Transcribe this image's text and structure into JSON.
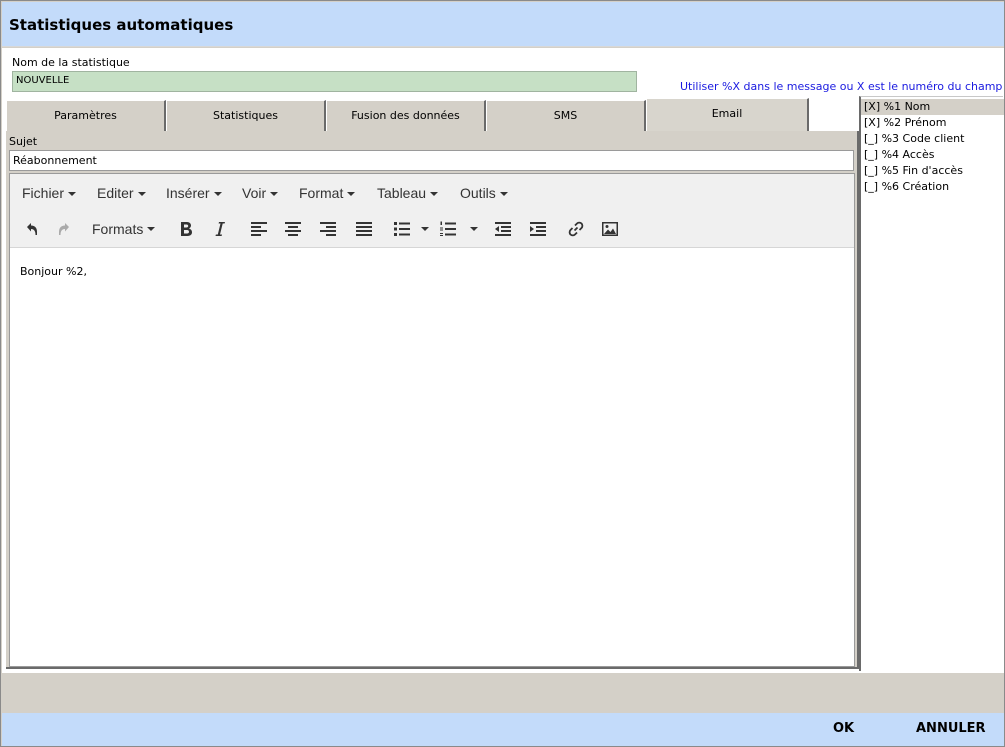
{
  "window": {
    "title": "Statistiques automatiques"
  },
  "form": {
    "name_label": "Nom de la statistique",
    "name_value": "NOUVELLE",
    "hint": "Utiliser %X dans le message ou X est le numéro du champ"
  },
  "tabs": [
    {
      "label": "Paramètres",
      "active": false
    },
    {
      "label": "Statistiques",
      "active": false
    },
    {
      "label": "Fusion des données",
      "active": false
    },
    {
      "label": "SMS",
      "active": false
    },
    {
      "label": "Email",
      "active": true
    }
  ],
  "email": {
    "subject_label": "Sujet",
    "subject_value": "Réabonnement",
    "menubar": [
      "Fichier",
      "Editer",
      "Insérer",
      "Voir",
      "Format",
      "Tableau",
      "Outils"
    ],
    "toolbar": {
      "formats_label": "Formats",
      "icons": [
        "undo-icon",
        "redo-icon",
        "bold-icon",
        "italic-icon",
        "align-left-icon",
        "align-center-icon",
        "align-right-icon",
        "justify-icon",
        "bullet-list-icon",
        "numbered-list-icon",
        "outdent-icon",
        "indent-icon",
        "link-icon",
        "image-icon"
      ]
    },
    "body_text": "Bonjour %2,"
  },
  "fields": [
    {
      "label": "[X] %1 Nom",
      "checked": true
    },
    {
      "label": "[X] %2 Prénom",
      "checked": true
    },
    {
      "label": "[_] %3 Code client",
      "checked": false
    },
    {
      "label": "[_] %4 Accès",
      "checked": false
    },
    {
      "label": "[_] %5 Fin d'accès",
      "checked": false
    },
    {
      "label": "[_] %6 Création",
      "checked": false
    }
  ],
  "footer": {
    "ok_label": "OK",
    "cancel_label": "ANNULER"
  },
  "colors": {
    "title_bar": "#c3dbfa",
    "name_input_bg": "#c6e0c5",
    "hint_text": "#1a1ae0",
    "panel_bg": "#d4d0c8"
  }
}
